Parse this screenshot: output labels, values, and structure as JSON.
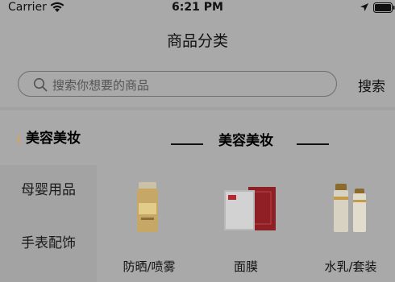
{
  "status_bar": {
    "carrier": "Carrier",
    "time": "6:21 PM"
  },
  "nav": {
    "title": "商品分类"
  },
  "search": {
    "placeholder": "搜索你想要的商品",
    "button_label": "搜索"
  },
  "sidebar": {
    "items": [
      {
        "label": "美容美妆",
        "active": true
      },
      {
        "label": "母婴用品",
        "active": false
      },
      {
        "label": "手表配饰",
        "active": false
      }
    ]
  },
  "content": {
    "section_title": "美容美妆",
    "products": [
      {
        "label": "防晒/喷雾",
        "icon": "sunscreen-bottle-icon"
      },
      {
        "label": "面膜",
        "icon": "face-mask-box-icon"
      },
      {
        "label": "水乳/套装",
        "icon": "lotion-set-icon"
      }
    ]
  },
  "colors": {
    "overlay_background": "#a9a9a9",
    "text": "#111111"
  }
}
